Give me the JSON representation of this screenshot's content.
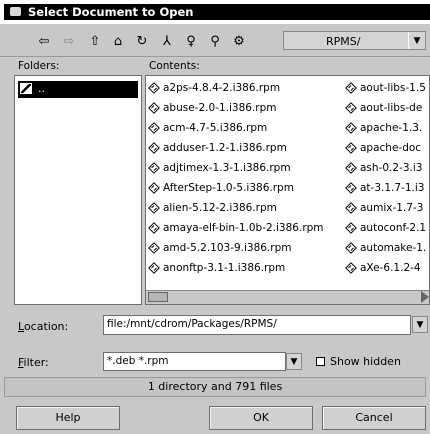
{
  "window": {
    "title": "Select Document to Open"
  },
  "toolbar": {
    "back_icon": "⇦",
    "forward_icon": "⇨",
    "up_icon": "⇧",
    "home_icon": "⌂",
    "reload_icon": "↻",
    "mkdir_icon": "⅄",
    "hint_icon": "♀",
    "find_icon": "⚲",
    "settings_icon": "⚙",
    "path": "RPMS/",
    "combo_arrow": "▼"
  },
  "folders": {
    "label": "Folders:",
    "items": [
      {
        "name": ".."
      }
    ]
  },
  "contents": {
    "label": "Contents:",
    "col1": [
      "a2ps-4.8.4-2.i386.rpm",
      "abuse-2.0-1.i386.rpm",
      "acm-4.7-5.i386.rpm",
      "adduser-1.2-1.i386.rpm",
      "adjtimex-1.3-1.i386.rpm",
      "AfterStep-1.0-5.i386.rpm",
      "alien-5.12-2.i386.rpm",
      "amaya-elf-bin-1.0b-2.i386.rpm",
      "amd-5.2.103-9.i386.rpm",
      "anonftp-3.1-1.i386.rpm"
    ],
    "col2": [
      "aout-libs-1.5",
      "aout-libs-de",
      "apache-1.3.",
      "apache-doc",
      "ash-0.2-3.i3",
      "at-3.1.7-1.i3",
      "aumix-1.7-3",
      "autoconf-2.1",
      "automake-1.",
      "aXe-6.1.2-4"
    ]
  },
  "location": {
    "label_u": "L",
    "label_rest": "ocation:",
    "value": "file:/mnt/cdrom/Packages/RPMS/"
  },
  "filter": {
    "label_u": "F",
    "label_rest": "ilter:",
    "value": "*.deb *.rpm",
    "show_hidden_label": "Show hidden"
  },
  "status": "1 directory and 791 files",
  "buttons": {
    "help": "Help",
    "ok": "OK",
    "cancel": "Cancel"
  }
}
